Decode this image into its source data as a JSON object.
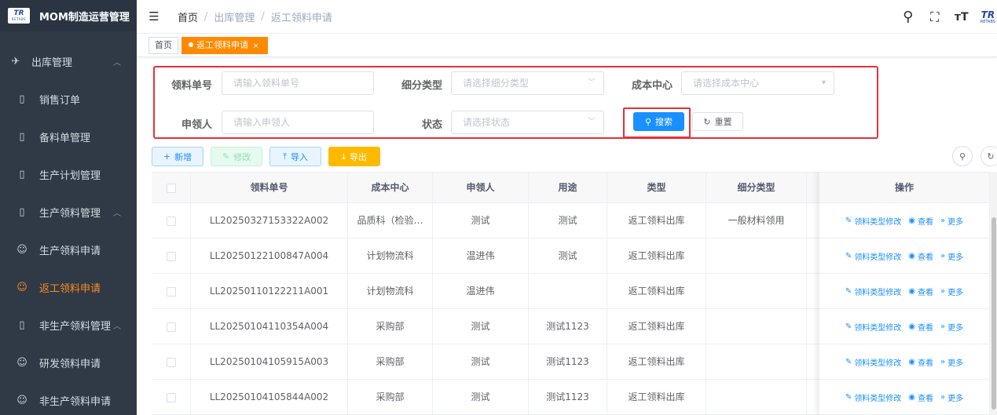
{
  "app": {
    "title": "MOM制造运营管理",
    "logo_text": "TR",
    "logo_sub": "RETABS"
  },
  "sidebar": {
    "items": [
      {
        "label": "出库管理",
        "icon": "send-icon",
        "glyph": "✈",
        "type": "group",
        "arrow": "︿"
      },
      {
        "label": "销售订单",
        "icon": "book-icon",
        "glyph": "▯",
        "type": "child"
      },
      {
        "label": "备料单管理",
        "icon": "book-icon",
        "glyph": "▯",
        "type": "child"
      },
      {
        "label": "生产计划管理",
        "icon": "book-icon",
        "glyph": "▯",
        "type": "child"
      },
      {
        "label": "生产领料管理",
        "icon": "book-icon",
        "glyph": "▯",
        "type": "child",
        "arrow": "︿"
      },
      {
        "label": "生产领料申请",
        "icon": "user-list-icon",
        "glyph": "☺",
        "type": "child"
      },
      {
        "label": "返工领料申请",
        "icon": "user-list-icon",
        "glyph": "☺",
        "type": "child",
        "active": true
      },
      {
        "label": "非生产领料管理",
        "icon": "book-icon",
        "glyph": "▯",
        "type": "child",
        "arrow": "︿"
      },
      {
        "label": "研发领料申请",
        "icon": "user-list-icon",
        "glyph": "☺",
        "type": "child"
      },
      {
        "label": "非生产领料申请",
        "icon": "user-list-icon",
        "glyph": "☺",
        "type": "child"
      }
    ]
  },
  "header": {
    "breadcrumb": [
      "首页",
      "出库管理",
      "返工领料申请"
    ],
    "sep": "/",
    "hamburger": "☰",
    "search_glyph": "⚲",
    "fullscreen_glyph": "⛶",
    "fontsize_glyph": "тT",
    "logo_text": "TR",
    "logo_sub": "RETABS"
  },
  "tags": {
    "home": "首页",
    "active": "返工领料申请",
    "close": "×"
  },
  "search": {
    "order_no_label": "领料单号",
    "order_no_placeholder": "请输入领料单号",
    "subtype_label": "细分类型",
    "subtype_placeholder": "请选择细分类型",
    "cost_center_label": "成本中心",
    "cost_center_placeholder": "请选择成本中心",
    "applicant_label": "申领人",
    "applicant_placeholder": "请输入申领人",
    "status_label": "状态",
    "status_placeholder": "请选择状态",
    "caret": "﹀",
    "caret_filled": "▾",
    "search_btn": "搜索",
    "search_glyph": "⚲",
    "reset_btn": "重置",
    "reset_glyph": "↻"
  },
  "toolbar": {
    "add": "新增",
    "add_glyph": "+",
    "edit": "修改",
    "edit_glyph": "✎",
    "import": "导入",
    "import_glyph": "⤒",
    "export": "导出",
    "export_glyph": "⤓",
    "search_glyph": "⚲",
    "refresh_glyph": "↻"
  },
  "table": {
    "columns": [
      "领料单号",
      "成本中心",
      "申领人",
      "用途",
      "类型",
      "细分类型",
      "操作"
    ],
    "rows": [
      {
        "no": "LL20250327153322A002",
        "cost": "品质科（检验…",
        "applicant": "测试",
        "purpose": "测试",
        "type": "返工领料出库",
        "subtype": "一般材料领用"
      },
      {
        "no": "LL20250122100847A004",
        "cost": "计划物流科",
        "applicant": "温进伟",
        "purpose": "测试",
        "type": "返工领料出库",
        "subtype": ""
      },
      {
        "no": "LL20250110122211A001",
        "cost": "计划物流科",
        "applicant": "温进伟",
        "purpose": "",
        "type": "返工领料出库",
        "subtype": ""
      },
      {
        "no": "LL20250104110354A004",
        "cost": "采购部",
        "applicant": "测试",
        "purpose": "测试1123",
        "type": "返工领料出库",
        "subtype": ""
      },
      {
        "no": "LL20250104105915A003",
        "cost": "采购部",
        "applicant": "测试",
        "purpose": "测试1123",
        "type": "返工领料出库",
        "subtype": ""
      },
      {
        "no": "LL20250104105844A002",
        "cost": "采购部",
        "applicant": "测试",
        "purpose": "测试1123",
        "type": "返工领料出库",
        "subtype": ""
      }
    ],
    "ops": {
      "edit_type": "领料类型修改",
      "edit_glyph": "✎",
      "view": "查看",
      "view_glyph": "◉",
      "more": "更多",
      "more_glyph": "»"
    }
  }
}
